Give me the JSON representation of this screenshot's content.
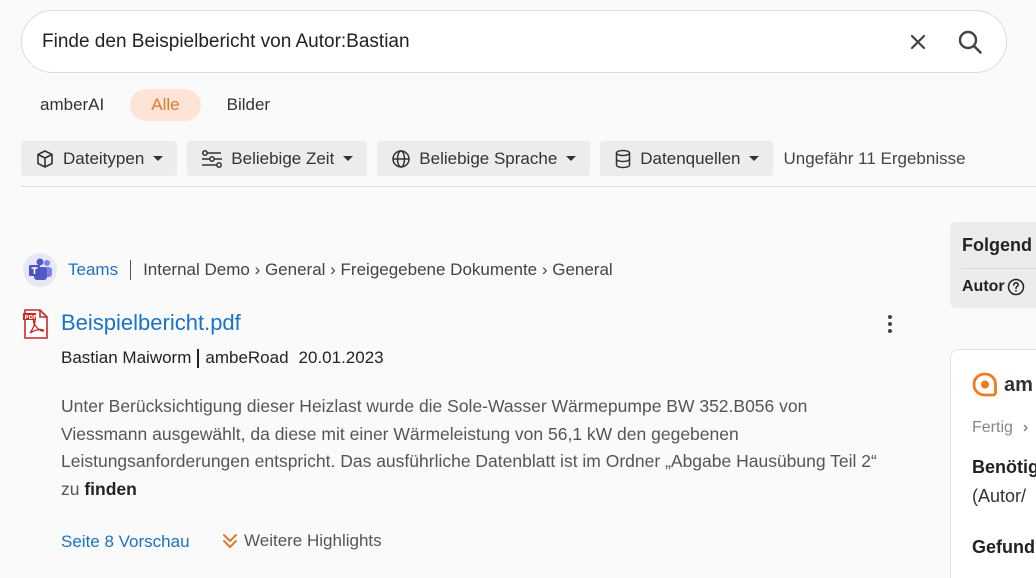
{
  "search": {
    "value": "Finde den Beispielbericht von Autor:Bastian",
    "clear_icon": "close-icon",
    "search_icon": "search-icon"
  },
  "tabs": [
    {
      "label": "amberAI",
      "active": false
    },
    {
      "label": "Alle",
      "active": true
    },
    {
      "label": "Bilder",
      "active": false
    }
  ],
  "filters": [
    {
      "label": "Dateitypen",
      "icon": "cube-icon"
    },
    {
      "label": "Beliebige Zeit",
      "icon": "timeline-icon"
    },
    {
      "label": "Beliebige Sprache",
      "icon": "globe-icon"
    },
    {
      "label": "Datenquellen",
      "icon": "database-icon"
    }
  ],
  "result_count": "Ungefähr 11 Ergebnisse",
  "result": {
    "source": "Teams",
    "breadcrumb": "Internal Demo › General › Freigegebene Dokumente › General",
    "title": "Beispielbericht.pdf",
    "author": "Bastian Maiworm",
    "location": "ambeRoad",
    "date": "20.01.2023",
    "snippet_text": "Unter Berücksichtigung dieser Heizlast wurde die Sole-Wasser Wärmepumpe BW 352.B056 von Viessmann ausgewählt, da diese mit einer Wärmeleistung von 56,1 kW den gegebenen Leistungsanforderungen entspricht. Das ausführliche Datenblatt ist im Ordner „Abgabe Hausübung Teil 2“ zu ",
    "snippet_bold": "finden",
    "preview_link": "Seite 8 Vorschau",
    "highlights_label": "Weitere Highlights"
  },
  "side_panel_1": {
    "header": "Folgend",
    "label": "Autor"
  },
  "side_panel_2": {
    "logo_text": "am",
    "status": "Fertig",
    "status_chevron": "›",
    "line1": "Benötig",
    "line2": "(Autor/",
    "line3": "Gefund"
  },
  "colors": {
    "accent": "#e07a2c",
    "link": "#1a73c8",
    "tab_active_bg": "#fde4d6"
  }
}
